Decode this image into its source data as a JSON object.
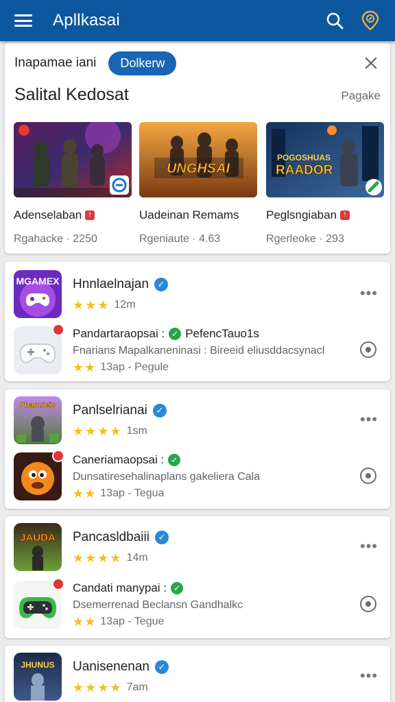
{
  "app_bar": {
    "title": "Apllkasai"
  },
  "filter": {
    "label": "Inapamae iani",
    "chip": "Dolkerw"
  },
  "featured": {
    "title": "Salital Kedosat",
    "link": "Pagake",
    "items": [
      {
        "name": "Adenselaban",
        "sub": "Rgahacke · 2250"
      },
      {
        "name": "Uadeinan Remams",
        "sub": "Rgeniaute · 4.63"
      },
      {
        "name": "Peglsngiaban",
        "sub": "Rgerleoke · 293"
      }
    ],
    "banner_texts": [
      "UNGHSAI",
      "POGOSHUAS",
      "RAADOR"
    ]
  },
  "groups": [
    {
      "main": {
        "title": "Hnnlaelnajan",
        "stars": 3,
        "meta": "12m",
        "icon_text": "MGAMEX"
      },
      "sub": {
        "title": "Pandartaraopsai :",
        "title2": "PefencTauo1s",
        "desc": "Fnarians Mapalkaneninasi : Bireeid eliusddacsynacl",
        "stars": 2,
        "meta": "13ap - Pegule"
      }
    },
    {
      "main": {
        "title": "Panlselrianai",
        "stars": 4,
        "meta": "1sm",
        "icon_text": "Phanuleio"
      },
      "sub": {
        "title": "Caneriamaopsai :",
        "title2": "",
        "desc": "Dunsatiresehalinaplans gakeliera Cala",
        "stars": 2,
        "meta": "13ap - Tegua"
      }
    },
    {
      "main": {
        "title": "Pancasldbaiii",
        "stars": 4,
        "meta": "14m",
        "icon_text": "JAUDA"
      },
      "sub": {
        "title": "Candati manypai :",
        "title2": "",
        "desc": "Dsemerrenad Beclansn Gandhalkc",
        "stars": 2,
        "meta": "13ap - Tegue"
      }
    },
    {
      "main": {
        "title": "Uanisenenan",
        "stars": 4,
        "meta": "7am",
        "icon_text": "JHUNUS"
      }
    }
  ]
}
